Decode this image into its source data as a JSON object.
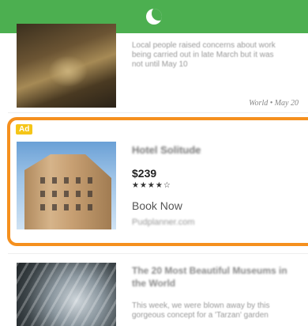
{
  "topbar": {
    "icon": "moon-icon",
    "color": "#4caf50"
  },
  "articles": [
    {
      "snippet_line1": "Local people raised concerns about work",
      "snippet_line2": "being carried out in late March but it was",
      "snippet_line3": "not until May 10",
      "meta": "World • May 20"
    },
    {
      "title": "The 20 Most Beautiful Museums in the World",
      "snippet_line1": "This week, we were blown away by this",
      "snippet_line2": "gorgeous concept for a 'Tarzan' garden"
    }
  ],
  "ad": {
    "badge": "Ad",
    "hotel_name": "Hotel Solitude",
    "price": "$239",
    "stars": "★★★★☆",
    "rating": 4,
    "cta": "Book Now",
    "domain": "Pudplanner.com",
    "accent": "#f5901e"
  }
}
